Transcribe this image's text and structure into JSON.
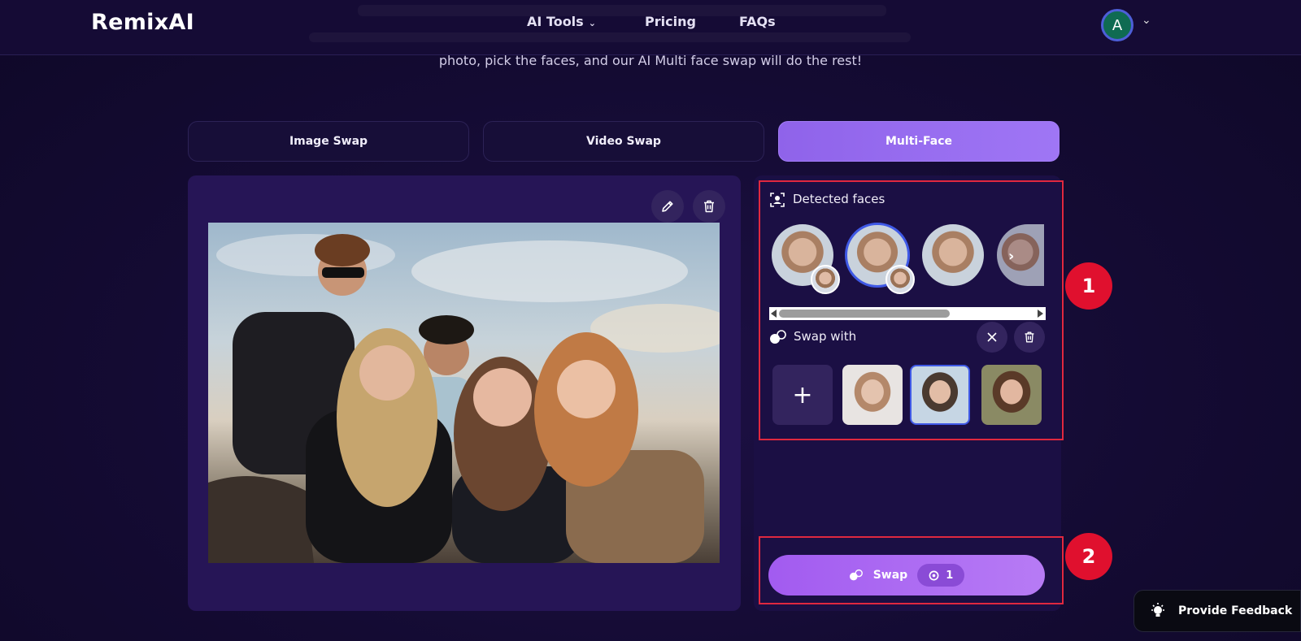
{
  "nav": {
    "logo": "RemixAI",
    "items": [
      {
        "label": "AI Tools",
        "has_dropdown": true
      },
      {
        "label": "Pricing"
      },
      {
        "label": "FAQs"
      }
    ],
    "avatar_initial": "A"
  },
  "hero": {
    "subtitle": "photo, pick the faces, and our AI Multi face swap will do the rest!"
  },
  "tabs": [
    {
      "label": "Image Swap",
      "active": false
    },
    {
      "label": "Video Swap",
      "active": false
    },
    {
      "label": "Multi-Face",
      "active": true
    }
  ],
  "right_panel": {
    "detected_faces_label": "Detected faces",
    "swap_with_label": "Swap with",
    "swap_button_label": "Swap",
    "credit_cost": "1"
  },
  "annotations": {
    "badge_1": "1",
    "badge_2": "2"
  },
  "feedback": {
    "label": "Provide Feedback"
  },
  "colors": {
    "background": "#140b33",
    "panel": "#261556",
    "accent": "#9f76f5",
    "annotation_red": "#e0102e"
  }
}
